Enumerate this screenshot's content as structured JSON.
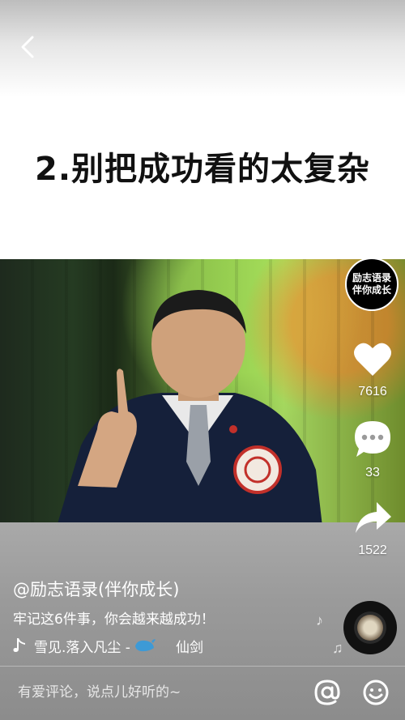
{
  "headline": "2.别把成功看的太复杂",
  "account_badge": {
    "line1": "励志语录",
    "line2": "伴你成长"
  },
  "actions": {
    "like_count": "7616",
    "comment_count": "33",
    "share_count": "1522"
  },
  "post": {
    "author": "@励志语录(伴你成长)",
    "caption": "牢记这6件事，你会越来越成功！",
    "music_title": "雪见.落入凡尘 - ",
    "music_artist": "仙剑"
  },
  "comment_bar": {
    "placeholder": "有爱评论，说点儿好听的~"
  },
  "colors": {
    "overlay_gray": "#9a9a9a",
    "text_white": "#ffffff",
    "headline": "#111111"
  },
  "icons": [
    "back-chevron-icon",
    "heart-icon",
    "comment-icon",
    "share-icon",
    "music-note-icon",
    "whale-icon",
    "at-icon",
    "smile-icon"
  ]
}
